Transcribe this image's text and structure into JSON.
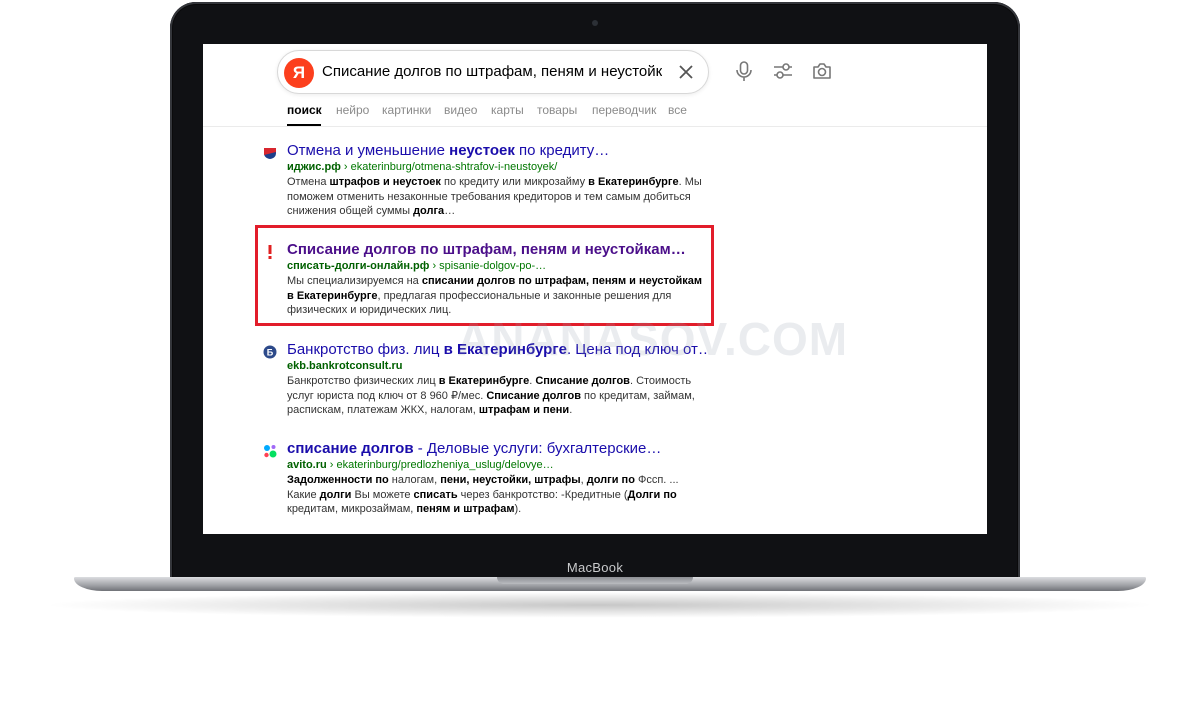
{
  "device": {
    "brand_label": "MacBook"
  },
  "search": {
    "logo": "Я",
    "query": "Списание долгов по штрафам, пеням и неустойка…"
  },
  "toolbar": {
    "icons": [
      "close-icon",
      "microphone-icon",
      "filters-icon",
      "camera-search-icon"
    ]
  },
  "tabs": [
    {
      "label": "поиск",
      "active": true
    },
    {
      "label": "нейро",
      "active": false
    },
    {
      "label": "картинки",
      "active": false
    },
    {
      "label": "видео",
      "active": false
    },
    {
      "label": "карты",
      "active": false
    },
    {
      "label": "товары",
      "active": false
    },
    {
      "label": "переводчик",
      "active": false
    },
    {
      "label": "все",
      "active": false
    }
  ],
  "results": [
    {
      "title_parts": [
        "Отмена и уменьшение ",
        "неустоек",
        " по кредиту…"
      ],
      "url_host": "иджис.рф",
      "url_path": " › ekaterinburg/otmena-shtrafov-i-neustoyek/",
      "snippet_parts": [
        "Отмена ",
        "штрафов и неустоек",
        " по кредиту или микрозайму ",
        "в Екатеринбурге",
        ". Мы поможем отменить незаконные требования кредиторов и тем самым добиться снижения общей суммы ",
        "долга",
        "…"
      ]
    },
    {
      "title_parts": [
        "Списание долгов по штрафам, пеням и неустойкам…"
      ],
      "url_host": "списать-долги-онлайн.рф",
      "url_path": " › spisanie-dolgov-po-…",
      "snippet_parts": [
        "Мы специализируемся на ",
        "списании долгов по штрафам, пеням и неустойкам в Екатеринбурге",
        ", предлагая профессиональные и законные решения для физических и юридических лиц."
      ]
    },
    {
      "title_parts": [
        "Банкротство физ. лиц ",
        "в Екатеринбурге",
        ". Цена под ключ от…"
      ],
      "url_host": "ekb.bankrotconsult.ru",
      "url_path": "",
      "snippet_parts": [
        "Банкротство физических лиц ",
        "в Екатеринбурге",
        ". ",
        "Списание долгов",
        ". Стоимость услуг юриста под ключ от 8 960 ₽/мес. ",
        "Списание долгов",
        " по кредитам, займам, распискам, платежам ЖКХ, налогам, ",
        "штрафам и пени",
        "."
      ]
    },
    {
      "title_parts": [
        "списание долгов",
        " - Деловые услуги: бухгалтерские…"
      ],
      "url_host": "avito.ru",
      "url_path": " › ekaterinburg/predlozheniya_uslug/delovye…",
      "snippet_parts": [
        "Задолженности по",
        " налогам, ",
        "пени, неустойки, штрафы",
        ", ",
        "долги по",
        " Фссп. ... Какие ",
        "долги",
        " Вы можете ",
        "списать",
        " через банкротство: -Кредитные (",
        "Долги по",
        " кредитам, микрозаймам, ",
        "пеням и штрафам",
        ")."
      ]
    }
  ],
  "watermark": "ANANASOV.COM",
  "colors": {
    "accent_red": "#fc3f1d",
    "highlight": "#e21d2a",
    "link": "#1a0dab",
    "url": "#007700"
  }
}
